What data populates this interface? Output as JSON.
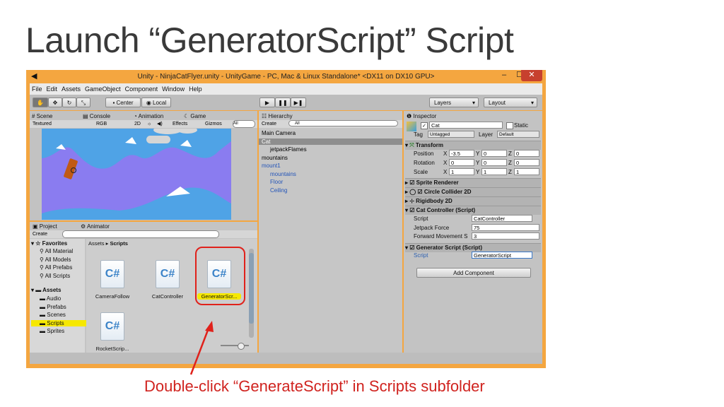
{
  "slide": {
    "title": "Launch “GeneratorScript” Script",
    "caption": "Double-click “GenerateScript” in Scripts subfolder"
  },
  "window": {
    "title": "Unity - NinjaCatFlyer.unity - UnityGame - PC, Mac & Linux Standalone* <DX11 on DX10 GPU>",
    "minimize": "–",
    "maximize": "☐",
    "close": "✕"
  },
  "menu": [
    "File",
    "Edit",
    "Assets",
    "GameObject",
    "Component",
    "Window",
    "Help"
  ],
  "toolbar": {
    "center": "Center",
    "local": "Local",
    "layers": "Layers",
    "layout": "Layout"
  },
  "scene": {
    "tabs": [
      "Scene",
      "Console",
      "Animation",
      "Game"
    ],
    "shading": "Textured",
    "rgb": "RGB",
    "mode_2d": "2D",
    "effects": "Effects",
    "gizmos": "Gizmos",
    "search": "All"
  },
  "hierarchy": {
    "tab": "Hierarchy",
    "create": "Create",
    "search": "All",
    "items": [
      {
        "label": "Main Camera",
        "indent": 0,
        "blue": false,
        "selected": false
      },
      {
        "label": "Cat",
        "indent": 0,
        "blue": false,
        "selected": true
      },
      {
        "label": "jetpackFlames",
        "indent": 1,
        "blue": false,
        "selected": false
      },
      {
        "label": "mountains",
        "indent": 0,
        "blue": false,
        "selected": false
      },
      {
        "label": "mount1",
        "indent": 0,
        "blue": true,
        "selected": false
      },
      {
        "label": "mountains",
        "indent": 1,
        "blue": true,
        "selected": false
      },
      {
        "label": "Floor",
        "indent": 1,
        "blue": true,
        "selected": false
      },
      {
        "label": "Ceiling",
        "indent": 1,
        "blue": true,
        "selected": false
      }
    ]
  },
  "inspector": {
    "tab": "Inspector",
    "object_name": "Cat",
    "static": "Static",
    "tag_label": "Tag",
    "tag_value": "Untagged",
    "layer_label": "Layer",
    "layer_value": "Default",
    "transform": {
      "header": "Transform",
      "position_label": "Position",
      "rotation_label": "Rotation",
      "scale_label": "Scale",
      "position": [
        "-3.5",
        "0",
        "0"
      ],
      "rotation": [
        "0",
        "0",
        "0"
      ],
      "scale": [
        "1",
        "1",
        "1"
      ]
    },
    "sprite_renderer": "Sprite Renderer",
    "circle_collider": "Circle Collider 2D",
    "rigidbody": "Rigidbody 2D",
    "cat_controller": {
      "header": "Cat Controller (Script)",
      "script_label": "Script",
      "script_value": "CatController",
      "jetpack_label": "Jetpack Force",
      "jetpack_value": "75",
      "forward_label": "Forward Movement S",
      "forward_value": "3"
    },
    "generator": {
      "header": "Generator Script (Script)",
      "script_label": "Script",
      "script_value": "GeneratorScript"
    },
    "add_component": "Add Component"
  },
  "project": {
    "tabs": [
      "Project",
      "Animator"
    ],
    "create": "Create",
    "breadcrumb": [
      "Assets",
      "Scripts"
    ],
    "favorites_header": "Favorites",
    "favorites": [
      "All Material",
      "All Models",
      "All Prefabs",
      "All Scripts"
    ],
    "assets_header": "Assets",
    "folders": [
      "Audio",
      "Prefabs",
      "Scenes",
      "Scripts",
      "Sprites"
    ],
    "selected_folder": "Scripts",
    "assets": [
      "CameraFollow",
      "CatController",
      "GeneratorScr...",
      "RocketScrip..."
    ],
    "selected_asset": "GeneratorScr..."
  },
  "colors": {
    "window_border": "#f4a640",
    "highlight_red": "#e0211b",
    "sky": "#8a7cf0",
    "selection_yellow": "#f6e800"
  }
}
